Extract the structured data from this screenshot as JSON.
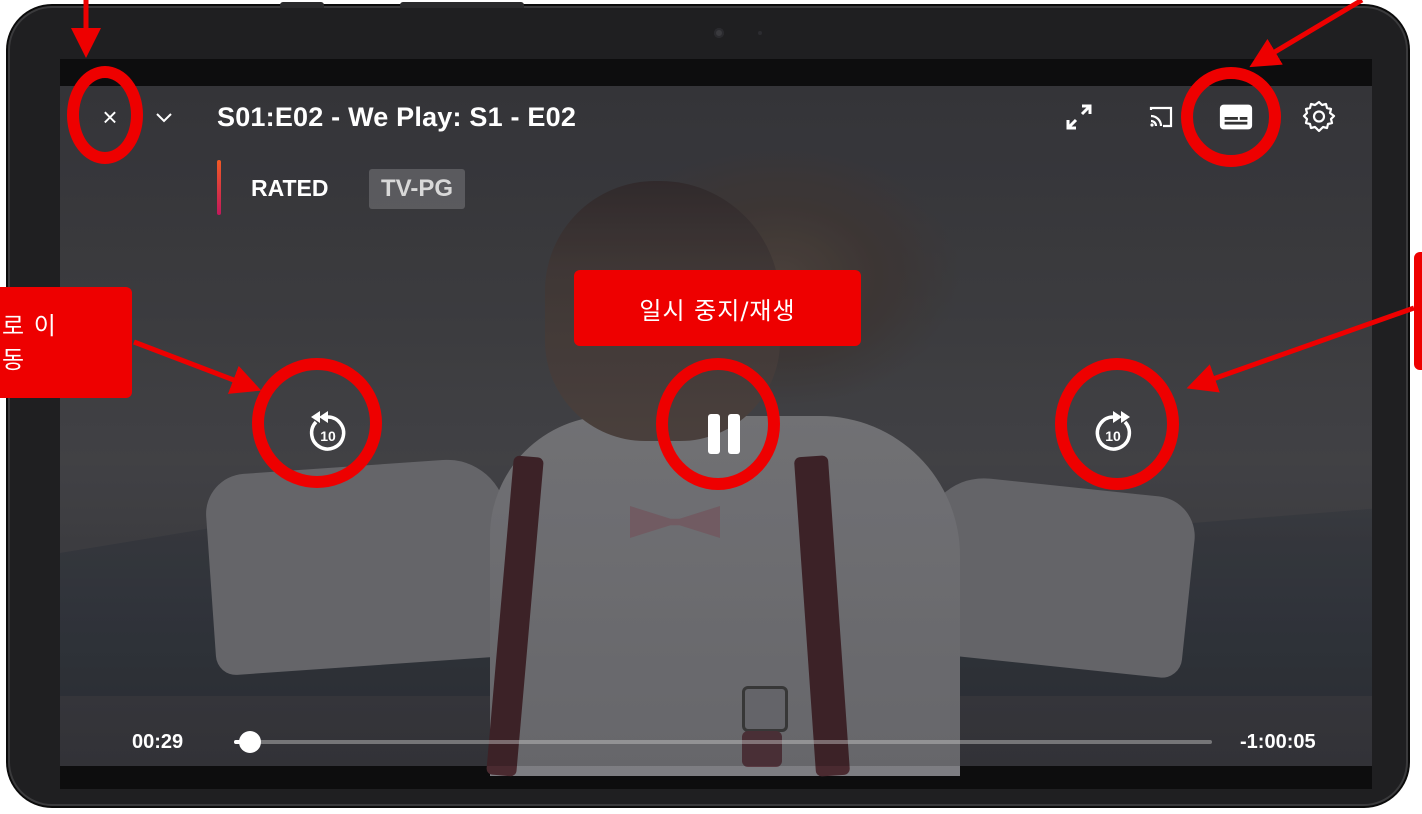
{
  "player": {
    "episode_title": "S01:E02 - We Play: S1 - E02",
    "rated_label": "RATED",
    "rating": "TV-PG",
    "time_elapsed": "00:29",
    "time_remaining": "-1:00:05",
    "progress": 0.008,
    "skip_seconds": "10"
  },
  "annotations": {
    "pause_play_label": "일시 중지/재생",
    "rewind_label_line1": "로 이",
    "rewind_label_line2": "동"
  },
  "icons": {
    "close": "close-icon",
    "dropdown": "chevron-down-icon",
    "fullscreen": "expand-icon",
    "cast": "cast-icon",
    "subtitles": "subtitles-icon",
    "settings": "gear-icon",
    "rewind": "rewind-10-icon",
    "pause": "pause-icon",
    "forward": "forward-10-icon"
  },
  "colors": {
    "annotation_red": "#ee0000",
    "rating_bar_top": "#f15a24",
    "rating_bar_bottom": "#c2185b"
  }
}
